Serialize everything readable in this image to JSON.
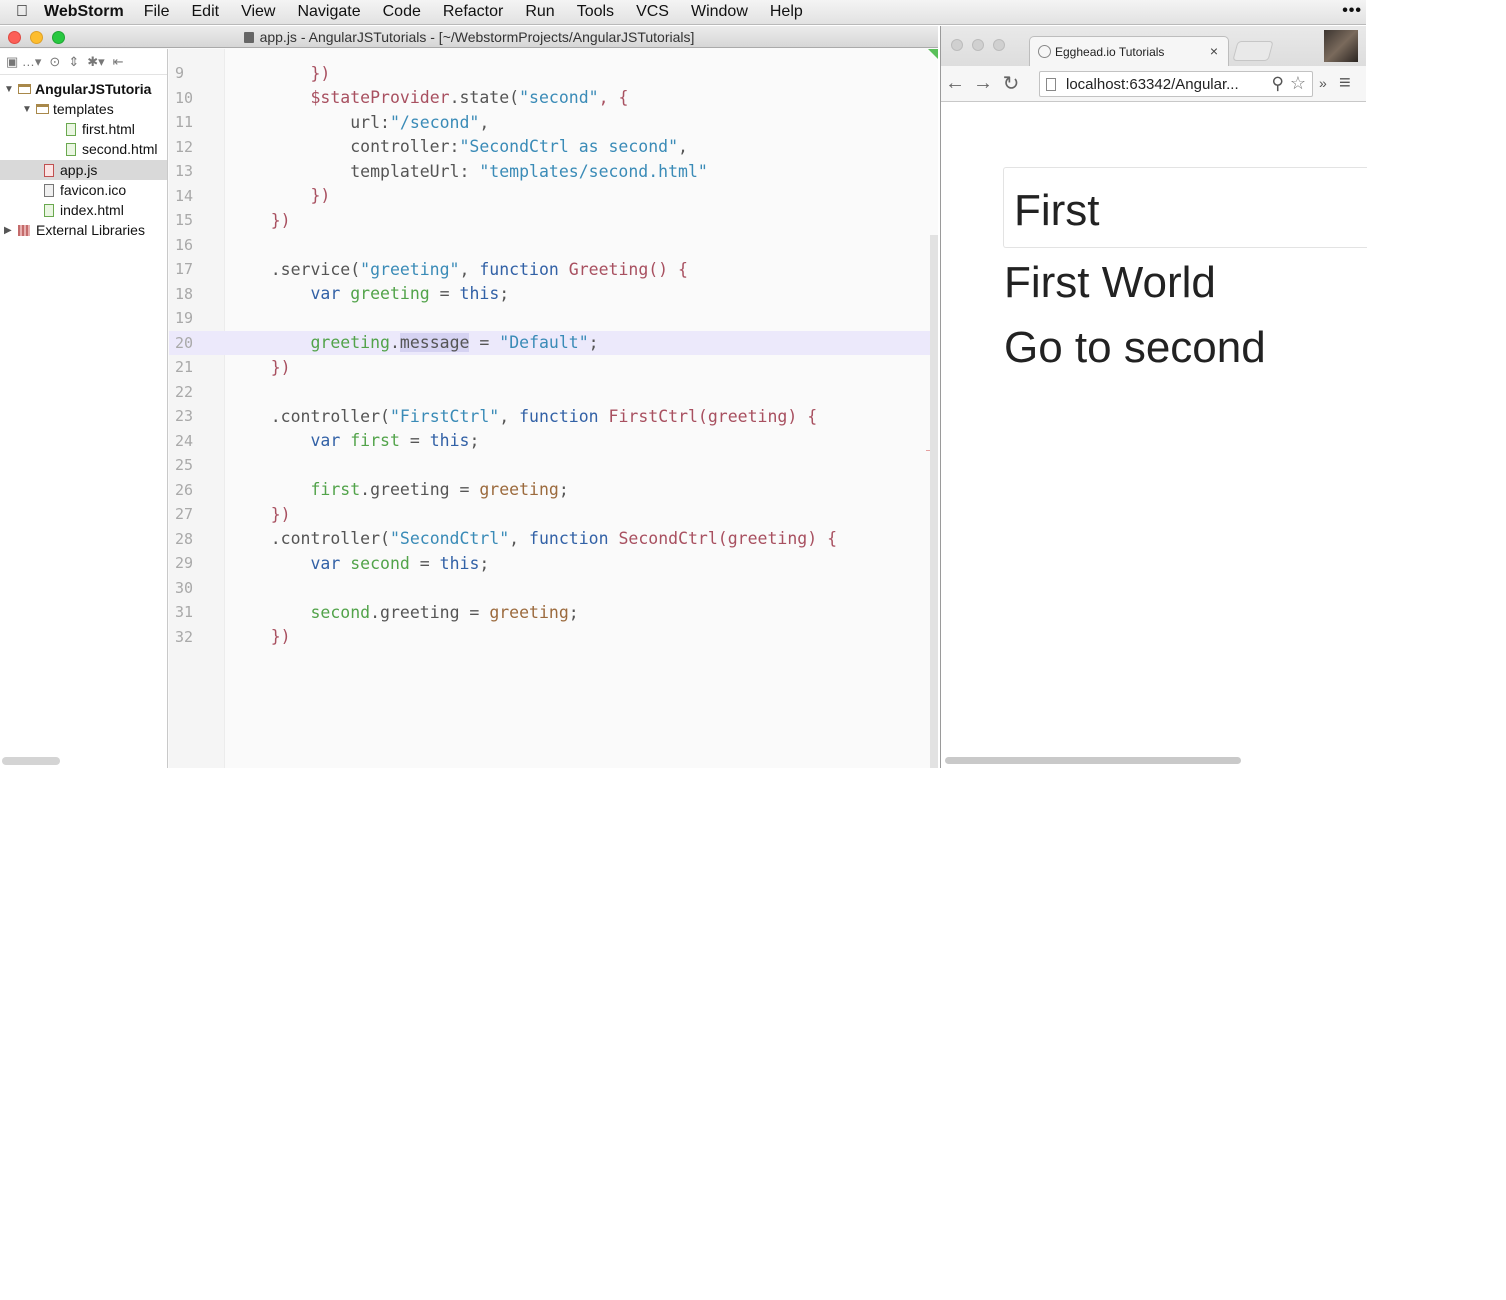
{
  "menubar": {
    "app_name": "WebStorm",
    "items": [
      "File",
      "Edit",
      "View",
      "Navigate",
      "Code",
      "Refactor",
      "Run",
      "Tools",
      "VCS",
      "Window",
      "Help"
    ],
    "overflow": "•••"
  },
  "ide": {
    "title": "app.js - AngularJSTutorials - [~/WebstormProjects/AngularJSTutorials]",
    "project_tree": [
      {
        "label": "AngularJSTutoria",
        "type": "folder",
        "expanded": true,
        "bold": true
      },
      {
        "label": "templates",
        "type": "folder",
        "expanded": true
      },
      {
        "label": "first.html",
        "type": "html"
      },
      {
        "label": "second.html",
        "type": "html"
      },
      {
        "label": "app.js",
        "type": "js",
        "selected": true
      },
      {
        "label": "favicon.ico",
        "type": "ico"
      },
      {
        "label": "index.html",
        "type": "html"
      },
      {
        "label": "External Libraries",
        "type": "lib",
        "expanded": false
      }
    ],
    "editor": {
      "lines": [
        {
          "n": "9",
          "tokens": [
            [
              "        ",
              "p"
            ],
            [
              "})",
              "fn"
            ]
          ]
        },
        {
          "n": "10",
          "tokens": [
            [
              "        ",
              "p"
            ],
            [
              "$stateProvider",
              "fn"
            ],
            [
              ".state(",
              "p"
            ],
            [
              "\"second\"",
              "str"
            ],
            [
              ", {",
              "fn"
            ]
          ]
        },
        {
          "n": "11",
          "tokens": [
            [
              "            url:",
              "p"
            ],
            [
              "\"/second\"",
              "str"
            ],
            [
              ",",
              "p"
            ]
          ]
        },
        {
          "n": "12",
          "tokens": [
            [
              "            controller:",
              "p"
            ],
            [
              "\"SecondCtrl as second\"",
              "str"
            ],
            [
              ",",
              "p"
            ]
          ]
        },
        {
          "n": "13",
          "tokens": [
            [
              "            templateUrl: ",
              "p"
            ],
            [
              "\"templates/second.html\"",
              "str"
            ]
          ]
        },
        {
          "n": "14",
          "tokens": [
            [
              "        ",
              "p"
            ],
            [
              "})",
              "fn"
            ]
          ]
        },
        {
          "n": "15",
          "tokens": [
            [
              "    ",
              "p"
            ],
            [
              "})",
              "fn"
            ]
          ]
        },
        {
          "n": "16",
          "tokens": []
        },
        {
          "n": "17",
          "tokens": [
            [
              "    .service(",
              "p"
            ],
            [
              "\"greeting\"",
              "str"
            ],
            [
              ", ",
              "p"
            ],
            [
              "function",
              "kw"
            ],
            [
              " Greeting() {",
              "fn"
            ]
          ]
        },
        {
          "n": "18",
          "tokens": [
            [
              "        ",
              "p"
            ],
            [
              "var",
              "kw"
            ],
            [
              " ",
              "p"
            ],
            [
              "greeting",
              "var"
            ],
            [
              " = ",
              "p"
            ],
            [
              "this",
              "kw"
            ],
            [
              ";",
              "p"
            ]
          ]
        },
        {
          "n": "19",
          "tokens": []
        },
        {
          "n": "20",
          "current": true,
          "tokens": [
            [
              "        ",
              "p"
            ],
            [
              "greeting",
              "var"
            ],
            [
              ".",
              "p"
            ],
            [
              "message",
              "hl"
            ],
            [
              " = ",
              "p"
            ],
            [
              "\"Default\"",
              "str"
            ],
            [
              ";",
              "p"
            ]
          ]
        },
        {
          "n": "21",
          "tokens": [
            [
              "    ",
              "p"
            ],
            [
              "})",
              "fn"
            ]
          ]
        },
        {
          "n": "22",
          "tokens": []
        },
        {
          "n": "23",
          "tokens": [
            [
              "    .controller(",
              "p"
            ],
            [
              "\"FirstCtrl\"",
              "str"
            ],
            [
              ", ",
              "p"
            ],
            [
              "function",
              "kw"
            ],
            [
              " FirstCtrl(greeting) {",
              "fn"
            ]
          ]
        },
        {
          "n": "24",
          "tokens": [
            [
              "        ",
              "p"
            ],
            [
              "var",
              "kw"
            ],
            [
              " ",
              "p"
            ],
            [
              "first",
              "var"
            ],
            [
              " = ",
              "p"
            ],
            [
              "this",
              "kw"
            ],
            [
              ";",
              "p"
            ]
          ]
        },
        {
          "n": "25",
          "tokens": []
        },
        {
          "n": "26",
          "tokens": [
            [
              "        ",
              "p"
            ],
            [
              "first",
              "var"
            ],
            [
              ".greeting = ",
              "p"
            ],
            [
              "greeting",
              "param"
            ],
            [
              ";",
              "p"
            ]
          ]
        },
        {
          "n": "27",
          "tokens": [
            [
              "    ",
              "p"
            ],
            [
              "})",
              "fn"
            ]
          ]
        },
        {
          "n": "28",
          "tokens": [
            [
              "    .controller(",
              "p"
            ],
            [
              "\"SecondCtrl\"",
              "str"
            ],
            [
              ", ",
              "p"
            ],
            [
              "function",
              "kw"
            ],
            [
              " SecondCtrl(greeting) {",
              "fn"
            ]
          ]
        },
        {
          "n": "29",
          "tokens": [
            [
              "        ",
              "p"
            ],
            [
              "var",
              "kw"
            ],
            [
              " ",
              "p"
            ],
            [
              "second",
              "var"
            ],
            [
              " = ",
              "p"
            ],
            [
              "this",
              "kw"
            ],
            [
              ";",
              "p"
            ]
          ]
        },
        {
          "n": "30",
          "tokens": []
        },
        {
          "n": "31",
          "tokens": [
            [
              "        ",
              "p"
            ],
            [
              "second",
              "var"
            ],
            [
              ".greeting = ",
              "p"
            ],
            [
              "greeting",
              "param"
            ],
            [
              ";",
              "p"
            ]
          ]
        },
        {
          "n": "32",
          "tokens": [
            [
              "    ",
              "p"
            ],
            [
              "})",
              "fn"
            ]
          ]
        }
      ]
    }
  },
  "browser": {
    "tab_title": "Egghead.io Tutorials",
    "tab_close": "×",
    "url": "localhost:63342/Angular...",
    "nav_back": "←",
    "nav_forward": "→",
    "nav_reload": "↻",
    "overflow": "»",
    "menu": "≡",
    "page": {
      "brand": "First",
      "message": "First World",
      "link": "Go to second"
    }
  },
  "colors": {
    "string": "#3a8bb7",
    "keyword": "#3261a6",
    "function": "#a85060",
    "variable": "#52a34a",
    "current_line": "#ece9fb"
  }
}
